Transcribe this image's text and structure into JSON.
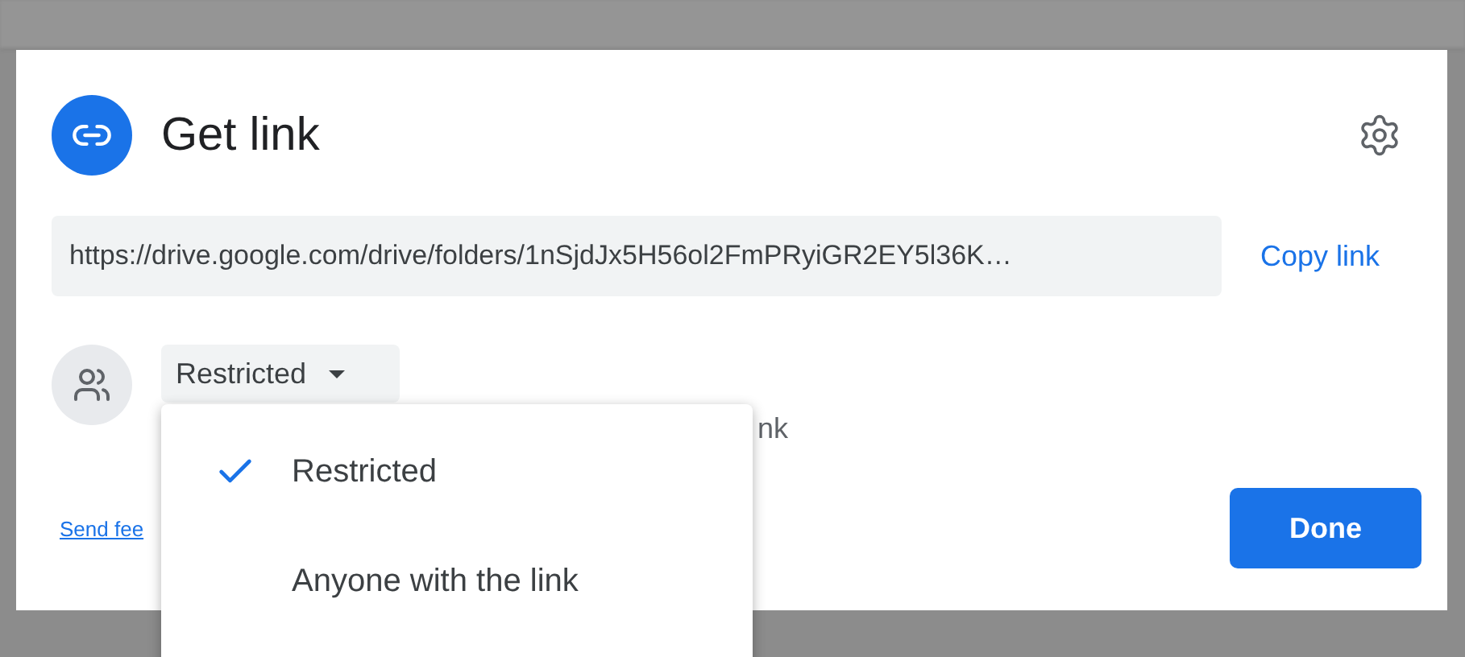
{
  "dialog": {
    "title": "Get link",
    "url": "https://drive.google.com/drive/folders/1nSjdJx5H56ol2FmPRyiGR2EY5l36K…",
    "copy_label": "Copy link",
    "access": {
      "value": "Restricted",
      "description_visible": "nk"
    },
    "feedback_link": "Send fee",
    "done_label": "Done"
  },
  "menu": {
    "items": [
      {
        "label": "Restricted",
        "selected": true
      },
      {
        "label": "Anyone with the link",
        "selected": false
      }
    ]
  }
}
